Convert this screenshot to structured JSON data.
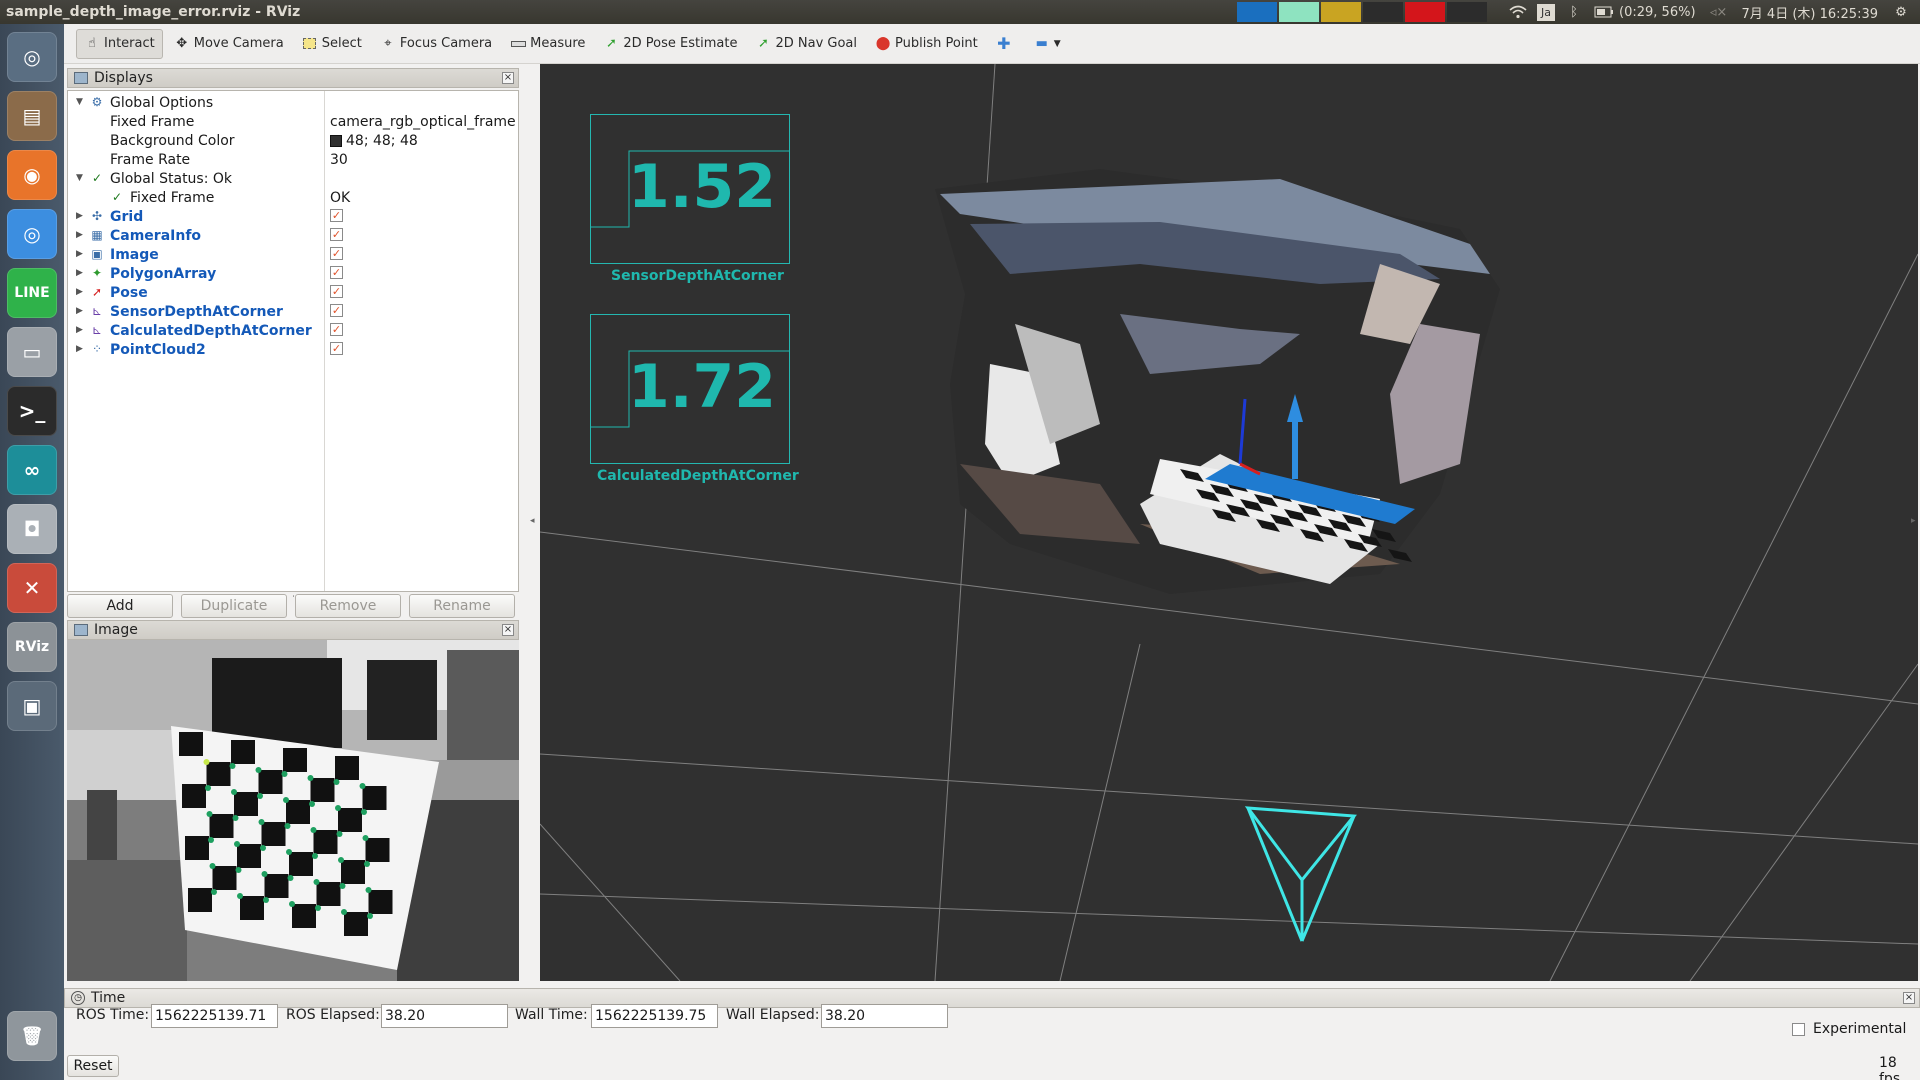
{
  "window_title": "sample_depth_image_error.rviz - RViz",
  "system_tray": {
    "swatches": [
      "#1a6fbf",
      "#8ee3c0",
      "#c9a422",
      "#3a3a3a",
      "#d4151b",
      "#3a3a3a"
    ],
    "keyboard": "Ja",
    "battery": "(0:29, 56%)",
    "clock": "7月 4日 (木) 16:25:39"
  },
  "launcher": [
    {
      "name": "dash",
      "label": "◎",
      "color": "#5a6e82"
    },
    {
      "name": "files",
      "label": "▤",
      "color": "#8b6b4a"
    },
    {
      "name": "firefox",
      "label": "◉",
      "color": "#e8742a"
    },
    {
      "name": "chrome",
      "label": "◎",
      "color": "#3c8ee0"
    },
    {
      "name": "line",
      "label": "LINE",
      "color": "#2fb24a"
    },
    {
      "name": "disk",
      "label": "▭",
      "color": "#9aa0a6"
    },
    {
      "name": "terminal",
      "label": ">_",
      "color": "#2b2b2b"
    },
    {
      "name": "arduino",
      "label": "∞",
      "color": "#1d8e99"
    },
    {
      "name": "camera",
      "label": "◘",
      "color": "#aab0b6"
    },
    {
      "name": "settings",
      "label": "✕",
      "color": "#c94b3b"
    },
    {
      "name": "rviz",
      "label": "RViz",
      "color": "#8c9297"
    },
    {
      "name": "workspace",
      "label": "▣",
      "color": "#5b6a79"
    }
  ],
  "toolbar": {
    "interact": "Interact",
    "move_camera": "Move Camera",
    "select": "Select",
    "focus_camera": "Focus Camera",
    "measure": "Measure",
    "pose_estimate": "2D Pose Estimate",
    "nav_goal": "2D Nav Goal",
    "publish_point": "Publish Point"
  },
  "displays": {
    "title": "Displays",
    "global_options": "Global Options",
    "fixed_frame_label": "Fixed Frame",
    "fixed_frame_value": "camera_rgb_optical_frame",
    "background_color_label": "Background Color",
    "background_color_value": "48; 48; 48",
    "frame_rate_label": "Frame Rate",
    "frame_rate_value": "30",
    "global_status": "Global Status: Ok",
    "status_fixed_frame": "Fixed Frame",
    "status_fixed_frame_value": "OK",
    "items": [
      {
        "label": "Grid",
        "icon": "grid-icon",
        "glyph": "✣",
        "color": "#3b6ea8"
      },
      {
        "label": "CameraInfo",
        "icon": "camera-info-icon",
        "glyph": "▦",
        "color": "#3b6ea8"
      },
      {
        "label": "Image",
        "icon": "image-icon",
        "glyph": "▣",
        "color": "#3b6ea8"
      },
      {
        "label": "PolygonArray",
        "icon": "polygon-icon",
        "glyph": "✦",
        "color": "#2e9a2e"
      },
      {
        "label": "Pose",
        "icon": "pose-arrow-icon",
        "glyph": "➚",
        "color": "#d62020"
      },
      {
        "label": "SensorDepthAtCorner",
        "icon": "plot-icon",
        "glyph": "⊾",
        "color": "#6a3fa8"
      },
      {
        "label": "CalculatedDepthAtCorner",
        "icon": "plot-icon",
        "glyph": "⊾",
        "color": "#6a3fa8"
      },
      {
        "label": "PointCloud2",
        "icon": "pointcloud-icon",
        "glyph": "⁘",
        "color": "#3b6ea8"
      }
    ]
  },
  "buttons": {
    "add": "Add",
    "duplicate": "Duplicate",
    "remove": "Remove",
    "rename": "Rename"
  },
  "image_panel": {
    "title": "Image"
  },
  "overlays": {
    "sensor_value": "1.52",
    "sensor_label": "SensorDepthAtCorner",
    "calculated_value": "1.72",
    "calculated_label": "CalculatedDepthAtCorner",
    "color": "#1fb8ae"
  },
  "time_panel": {
    "title": "Time",
    "ros_time_label": "ROS Time:",
    "ros_time": "1562225139.71",
    "ros_elapsed_label": "ROS Elapsed:",
    "ros_elapsed": "38.20",
    "wall_time_label": "Wall Time:",
    "wall_time": "1562225139.75",
    "wall_elapsed_label": "Wall Elapsed:",
    "wall_elapsed": "38.20",
    "experimental": "Experimental",
    "reset": "Reset",
    "fps": "18 fps"
  }
}
